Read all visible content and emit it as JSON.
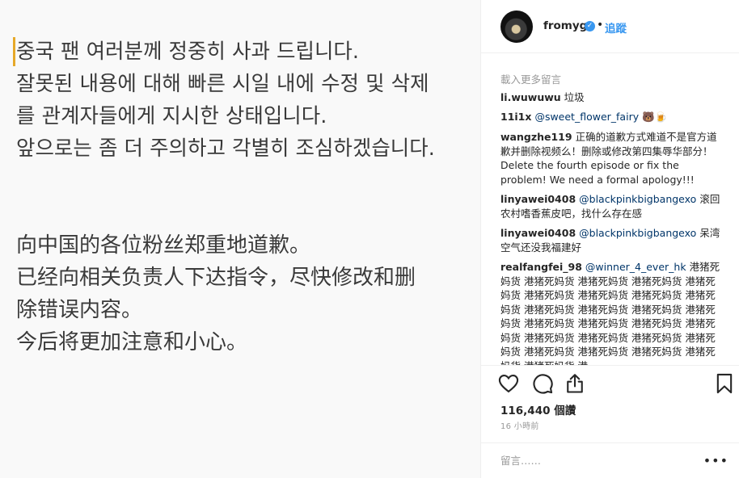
{
  "post": {
    "korean_lines": [
      "중국 팬 여러분께 정중히 사과 드립니다.",
      "잘못된 내용에 대해 빠른 시일 내에 수정 및 삭제",
      "를 관계자들에게 지시한 상태입니다.",
      "앞으로는 좀 더 주의하고 각별히 조심하겠습니다."
    ],
    "chinese_lines": [
      "向中国的各位粉丝郑重地道歉。",
      "已经向相关负责人下达指令，尽快修改和删",
      "除错误内容。",
      "今后将更加注意和小心。"
    ]
  },
  "header": {
    "username": "fromyg",
    "verified_icon": "verified-badge-icon",
    "separator": "•",
    "follow_label": "追蹤"
  },
  "comments": {
    "load_more": "載入更多留言",
    "items": [
      {
        "user": "li.wuwuwu",
        "mention": "",
        "text": "垃圾"
      },
      {
        "user": "11i1x",
        "mention": "@sweet_flower_fairy",
        "text": "🐻🍺"
      },
      {
        "user": "wangzhe119",
        "mention": "",
        "text": "正确的道歉方式难道不是官方道歉并删除视频么！删除或修改第四集辱华部分！Delete the fourth episode or fix the problem! We need a formal apology!!!"
      },
      {
        "user": "linyawei0408",
        "mention": "@blackpinkbigbangexo",
        "text": "滚回农村嗜香蕉皮吧，找什么存在感"
      },
      {
        "user": "linyawei0408",
        "mention": "@blackpinkbigbangexo",
        "text": "呆湾空气还没我福建好"
      },
      {
        "user": "realfangfei_98",
        "mention": "@winner_4_ever_hk",
        "text": "港猪死妈货 港猪死妈货 港猪死妈货 港猪死妈货 港猪死妈货 港猪死妈货 港猪死妈货 港猪死妈货 港猪死妈货 港猪死妈货 港猪死妈货 港猪死妈货 港猪死妈货 港猪死妈货 港猪死妈货 港猪死妈货 港猪死妈货 港猪死妈货 港猪死妈货 港猪死妈货 港猪死妈货 港猪死妈货 港猪死妈货 港猪死妈货 港猪死妈货 港猪死妈货 港"
      }
    ]
  },
  "actions": {
    "like_icon": "heart-icon",
    "comment_icon": "comment-bubble-icon",
    "share_icon": "share-icon",
    "save_icon": "bookmark-icon",
    "likes": "116,440 個讚",
    "time_ago": "16 小時前"
  },
  "add_comment": {
    "placeholder": "留言……",
    "more_icon": "more-options-icon"
  },
  "colors": {
    "accent": "#3897f0",
    "cursor": "#e6a92a",
    "muted": "#999999"
  }
}
